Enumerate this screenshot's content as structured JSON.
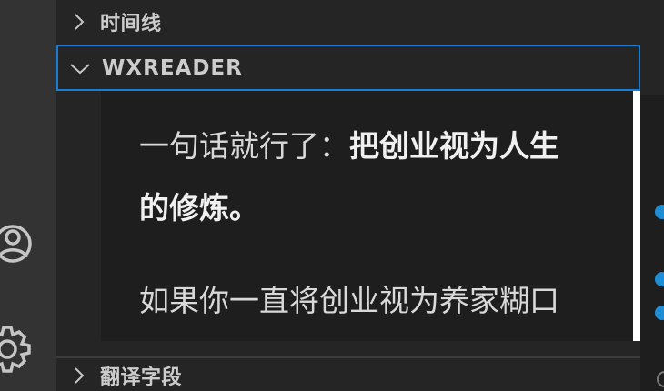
{
  "sidebar": {
    "sections": {
      "timeline": "时间线",
      "wxreader": "WXREADER",
      "translate": "翻译字段"
    }
  },
  "reader": {
    "line1_normal": "一句话就行了：",
    "line1_bold": "把创业视为人生",
    "line2_bold": "的修炼。",
    "line3": "如果你一直将创业视为养家糊口"
  },
  "icons": {
    "account": "account-icon",
    "settings": "gear-icon",
    "chevron_right": "chevron-right-icon",
    "chevron_down": "chevron-down-icon"
  },
  "colors": {
    "accent": "#1a7dd0",
    "dot": "#1e8fd6"
  }
}
